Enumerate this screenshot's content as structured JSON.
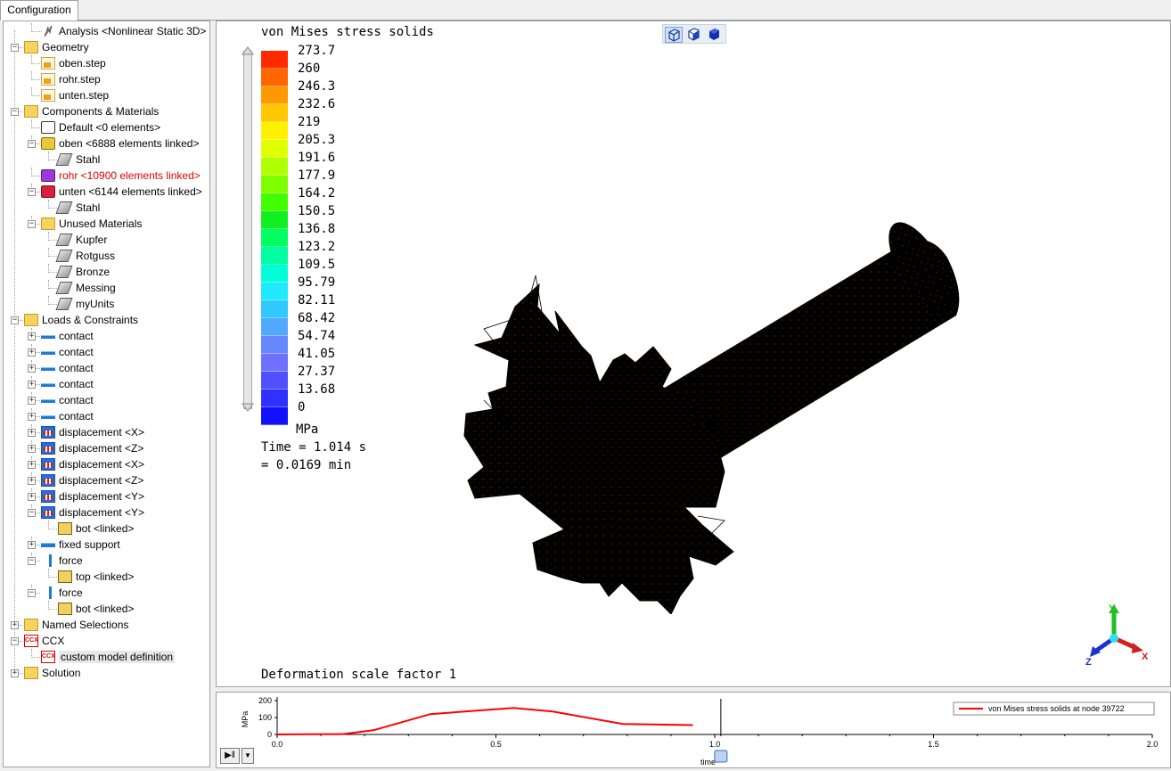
{
  "tab": {
    "label": "Configuration"
  },
  "tree": {
    "rows": [
      {
        "label": "Analysis <Nonlinear Static 3D>",
        "icon": "analysis-icon"
      },
      {
        "label": "Geometry",
        "icon": "folder-icon"
      },
      {
        "label": "oben.step",
        "icon": "step-file-icon"
      },
      {
        "label": "rohr.step",
        "icon": "step-file-icon"
      },
      {
        "label": "unten.step",
        "icon": "step-file-icon"
      },
      {
        "label": "Components & Materials",
        "icon": "components-folder-icon"
      },
      {
        "label": "Default <0 elements>",
        "icon": "component-icon"
      },
      {
        "label": "oben <6888 elements linked>",
        "icon": "component-icon"
      },
      {
        "label": "Stahl",
        "icon": "material-icon"
      },
      {
        "label": "rohr <10900 elements linked>",
        "icon": "component-icon"
      },
      {
        "label": "unten <6144 elements linked>",
        "icon": "component-icon"
      },
      {
        "label": "Stahl",
        "icon": "material-icon"
      },
      {
        "label": "Unused Materials",
        "icon": "unused-materials-folder-icon"
      },
      {
        "label": "Kupfer",
        "icon": "material-icon"
      },
      {
        "label": "Rotguss",
        "icon": "material-icon"
      },
      {
        "label": "Bronze",
        "icon": "material-icon"
      },
      {
        "label": "Messing",
        "icon": "material-icon"
      },
      {
        "label": "myUnits",
        "icon": "material-icon"
      },
      {
        "label": "Loads & Constraints",
        "icon": "loads-folder-icon"
      },
      {
        "label": "contact",
        "icon": "contact-icon"
      },
      {
        "label": "contact",
        "icon": "contact-icon"
      },
      {
        "label": "contact",
        "icon": "contact-icon"
      },
      {
        "label": "contact",
        "icon": "contact-icon"
      },
      {
        "label": "contact",
        "icon": "contact-icon"
      },
      {
        "label": "contact",
        "icon": "contact-icon"
      },
      {
        "label": "displacement <X>",
        "icon": "displacement-icon"
      },
      {
        "label": "displacement <Z>",
        "icon": "displacement-icon"
      },
      {
        "label": "displacement <X>",
        "icon": "displacement-icon"
      },
      {
        "label": "displacement <Z>",
        "icon": "displacement-icon"
      },
      {
        "label": "displacement <Y>",
        "icon": "displacement-icon"
      },
      {
        "label": "displacement <Y>",
        "icon": "displacement-icon"
      },
      {
        "label": "bot <linked>",
        "icon": "selection-box-icon"
      },
      {
        "label": "fixed support",
        "icon": "fixed-support-icon"
      },
      {
        "label": "force",
        "icon": "force-icon"
      },
      {
        "label": "top <linked>",
        "icon": "selection-box-icon"
      },
      {
        "label": "force",
        "icon": "force-icon"
      },
      {
        "label": "bot <linked>",
        "icon": "selection-box-icon"
      },
      {
        "label": "Named Selections",
        "icon": "named-selections-folder-icon"
      },
      {
        "label": "CCX",
        "icon": "ccx-icon"
      },
      {
        "label": "custom model definition",
        "icon": "ccx-definition-icon"
      },
      {
        "label": "Solution",
        "icon": "solution-folder-icon"
      }
    ]
  },
  "viewport": {
    "title": "von Mises stress solids",
    "unit": "MPa",
    "time_line1": "Time = 1.014 s",
    "time_line2": "= 0.0169 min",
    "deformation": "Deformation scale factor 1",
    "legend_values": [
      "273.7",
      "260",
      "246.3",
      "232.6",
      "219",
      "205.3",
      "191.6",
      "177.9",
      "164.2",
      "150.5",
      "136.8",
      "123.2",
      "109.5",
      "95.79",
      "82.11",
      "68.42",
      "54.74",
      "41.05",
      "27.37",
      "13.68",
      "0"
    ],
    "legend_colors": [
      "#ff2a00",
      "#ff6600",
      "#ff9900",
      "#ffc800",
      "#fff000",
      "#e0ff00",
      "#b0ff00",
      "#80ff00",
      "#40ff00",
      "#10f020",
      "#00ff60",
      "#00ffa0",
      "#00ffd8",
      "#20e8ff",
      "#30c8ff",
      "#50a8ff",
      "#6888ff",
      "#7070ff",
      "#5050ff",
      "#3030ff",
      "#1010ff"
    ],
    "axes": {
      "x": "X",
      "y": "Y",
      "z": "Z"
    }
  },
  "timechart": {
    "legend": "von Mises stress solids at node 39722",
    "ylabel": "MPa",
    "xlabel": "time",
    "yticks": [
      "200",
      "100",
      "0"
    ],
    "xticks": [
      "0.0",
      "0.5",
      "1.0",
      "1.5",
      "2.0"
    ],
    "line_color": "#ff0000"
  },
  "chart_data": {
    "type": "line",
    "title": "",
    "xlabel": "time",
    "ylabel": "MPa",
    "xlim": [
      0,
      2.0
    ],
    "ylim": [
      0,
      200
    ],
    "series": [
      {
        "name": "von Mises stress solids at node 39722",
        "x": [
          0.0,
          0.07,
          0.15,
          0.22,
          0.35,
          0.54,
          0.63,
          0.79,
          0.95
        ],
        "values": [
          0,
          1,
          2,
          25,
          120,
          157,
          135,
          62,
          55
        ]
      }
    ]
  }
}
